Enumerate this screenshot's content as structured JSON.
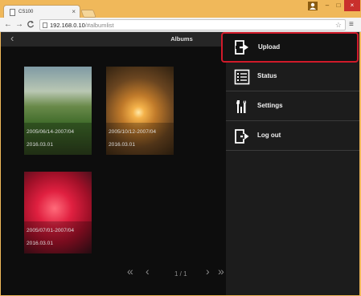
{
  "browser": {
    "tab_title": "CS100",
    "tab_close": "×",
    "url_host": "192.168.0.10",
    "url_path": "/#albumlist",
    "nav_back": "←",
    "nav_forward": "→",
    "nav_reload": "C",
    "star": "☆",
    "menu": "≡",
    "win_user": "👤",
    "win_min": "–",
    "win_max": "□",
    "win_close": "×"
  },
  "app": {
    "title": "Albums",
    "back": "‹"
  },
  "albums": [
    {
      "date_range": "2005/06/14-2007/04",
      "date_created": "2016.03.01"
    },
    {
      "date_range": "2005/10/12-2007/04",
      "date_created": "2016.03.01"
    },
    {
      "date_range": "2005/07/01-2007/04",
      "date_created": "2016.03.01"
    }
  ],
  "pager": {
    "first": "«",
    "prev": "‹",
    "page": "1 / 1",
    "next": "›",
    "last": "»"
  },
  "menu": {
    "items": [
      {
        "label": "Upload",
        "icon": "upload-icon"
      },
      {
        "label": "Status",
        "icon": "status-list-icon"
      },
      {
        "label": "Settings",
        "icon": "settings-tools-icon"
      },
      {
        "label": "Log out",
        "icon": "logout-icon"
      }
    ],
    "highlight_color": "#d11a2a"
  }
}
